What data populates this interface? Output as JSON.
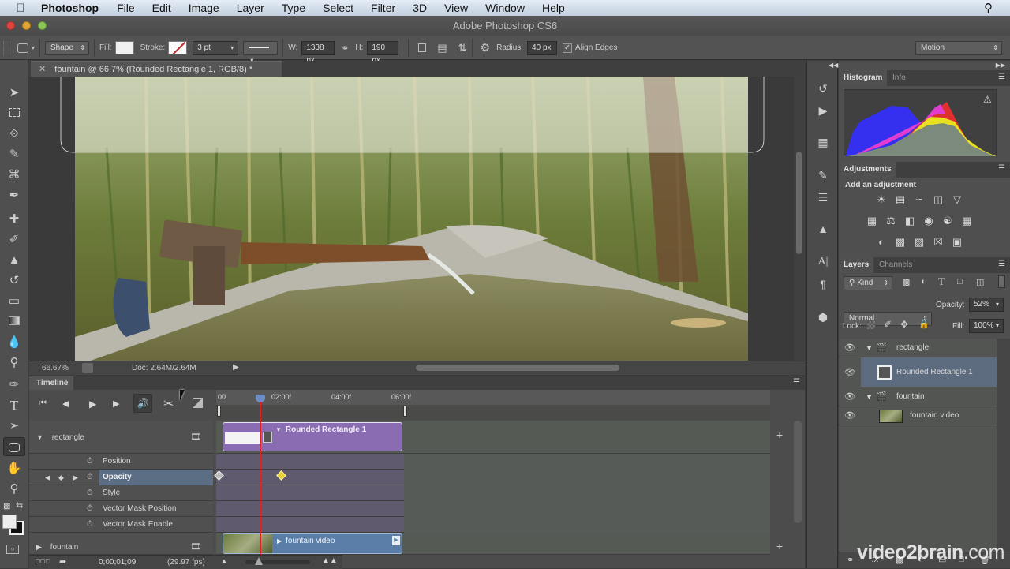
{
  "menubar": {
    "app": "Photoshop",
    "items": [
      "File",
      "Edit",
      "Image",
      "Layer",
      "Type",
      "Select",
      "Filter",
      "3D",
      "View",
      "Window",
      "Help"
    ]
  },
  "window": {
    "title": "Adobe Photoshop CS6"
  },
  "options": {
    "mode": "Shape",
    "fill_label": "Fill:",
    "stroke_label": "Stroke:",
    "stroke_width": "3 pt",
    "w_label": "W:",
    "width": "1338 px",
    "h_label": "H:",
    "height": "190 px",
    "radius_label": "Radius:",
    "radius": "40 px",
    "align_edges_label": "Align Edges",
    "align_edges_checked": true,
    "workspace": "Motion"
  },
  "document": {
    "tab_title": "fountain @ 66.7% (Rounded Rectangle 1, RGB/8) *",
    "zoom": "66.67%",
    "doc_size": "Doc: 2.64M/2.64M"
  },
  "timeline": {
    "tab": "Timeline",
    "ruler": [
      "00",
      "02:00f",
      "04:00f",
      "06:00f"
    ],
    "current_time": "0;00;01;09",
    "fps": "(29.97 fps)",
    "groups": [
      {
        "name": "rectangle",
        "clip": "Rounded Rectangle 1",
        "properties": [
          "Position",
          "Opacity",
          "Style",
          "Vector Mask Position",
          "Vector Mask Enable"
        ],
        "selected_property": "Opacity"
      },
      {
        "name": "fountain",
        "clip": "fountain video"
      }
    ],
    "clip_colors": {
      "shape": "#8a6cb3",
      "video": "#5a7ea8"
    }
  },
  "panels": {
    "histogram_tabs": [
      "Histogram",
      "Info"
    ],
    "adjustments_tab": "Adjustments",
    "adjustments_title": "Add an adjustment",
    "layers_tabs": [
      "Layers",
      "Channels"
    ],
    "filter_kind": "Kind",
    "blend_mode": "Normal",
    "opacity_label": "Opacity:",
    "opacity": "52%",
    "lock_label": "Lock:",
    "fill_label": "Fill:",
    "fill": "100%",
    "layers": [
      {
        "name": "rectangle",
        "type": "group",
        "expanded": true
      },
      {
        "name": "Rounded Rectangle 1",
        "type": "shape",
        "selected": true
      },
      {
        "name": "fountain",
        "type": "group",
        "expanded": true
      },
      {
        "name": "fountain video",
        "type": "video"
      }
    ]
  },
  "watermark": {
    "brand": "video2brain",
    "suffix": ".com"
  }
}
